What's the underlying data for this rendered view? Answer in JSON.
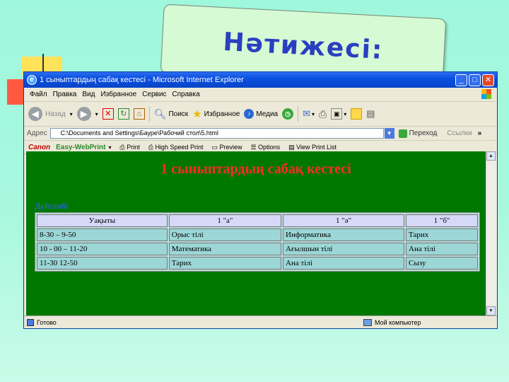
{
  "slide": {
    "title": "Нәтижесі:"
  },
  "window": {
    "title": "1 сыныптардың сабақ кестесі - Microsoft Internet Explorer",
    "minimize": "_",
    "maximize": "□",
    "close": "✕"
  },
  "menu": [
    "Файл",
    "Правка",
    "Вид",
    "Избранное",
    "Сервис",
    "Справка"
  ],
  "toolbar": {
    "back": "Назад",
    "search": "Поиск",
    "favorites": "Избранное",
    "media": "Медиа"
  },
  "address": {
    "label": "Адрес",
    "value": "C:\\Documents and Settings\\Бауре\\Рабочий стол\\5.html",
    "go": "Переход",
    "links": "Ссылки"
  },
  "canonbar": {
    "brand": "Canon",
    "product": "Easy-WebPrint",
    "print": "Print",
    "high_speed": "High Speed Print",
    "preview": "Preview",
    "options": "Options",
    "view_list": "View Print List"
  },
  "page": {
    "heading": "1 сыныптардың сабақ кестесі",
    "day": "Дүйсенбі",
    "table": {
      "headers": [
        "Уақыты",
        "1 \"а\"",
        "1 \"ә\"",
        "1 \"б\""
      ],
      "rows": [
        [
          "8-30 – 9-50",
          "Орыс тілі",
          "Информатика",
          "Тарих"
        ],
        [
          "10 - 00 – 11-20",
          "Математика",
          "Ағылшын тілі",
          "Ана тілі"
        ],
        [
          "11-30 12-50",
          "Тарих",
          "Ана тілі",
          "Сызу"
        ]
      ]
    }
  },
  "status": {
    "text": "Готово",
    "zone": "Мой компьютер"
  },
  "colors": {
    "page_bg": "#007800",
    "heading": "#ff2a2a",
    "day": "#3060ff",
    "slide_bg": "#a8f8de"
  }
}
